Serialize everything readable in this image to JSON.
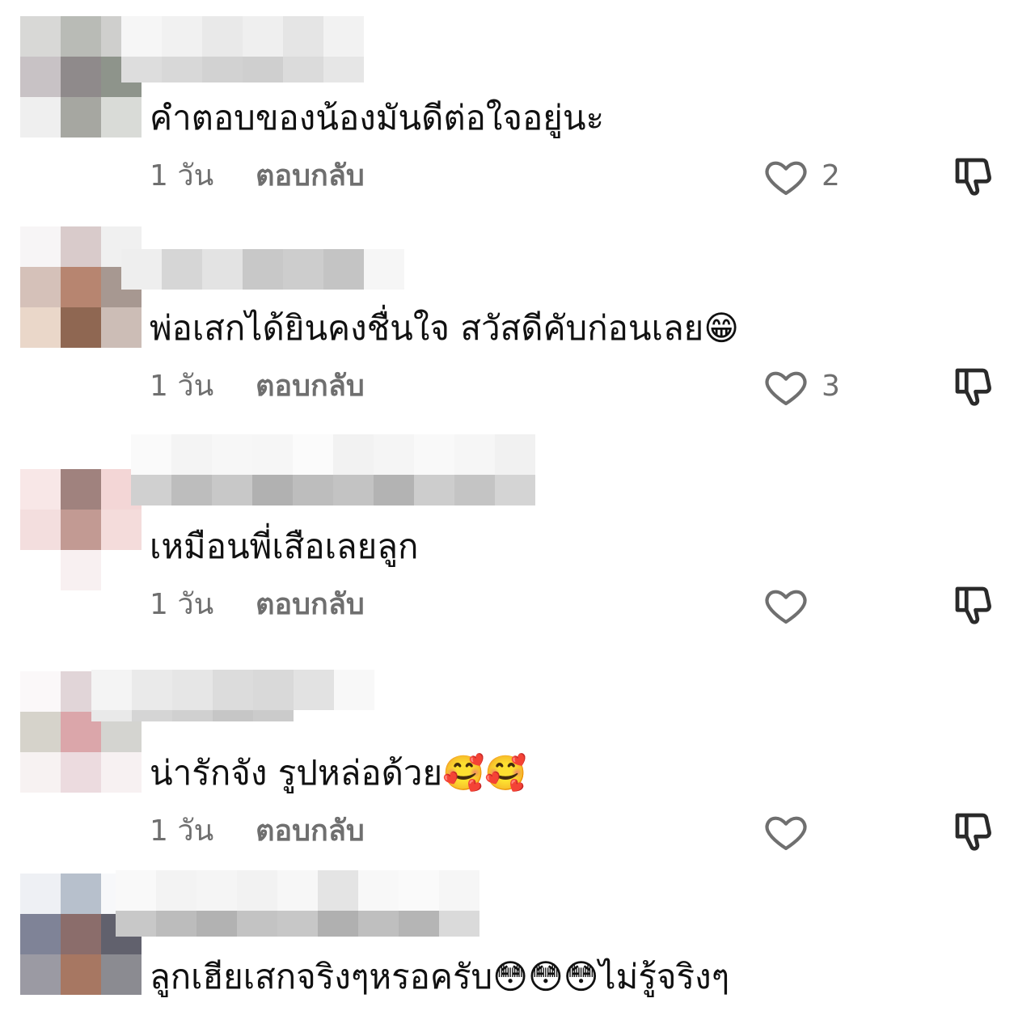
{
  "comments": [
    {
      "text": "คำตอบของน้องมันดีต่อใจอยู่นะ",
      "time": "1 วัน",
      "reply_label": "ตอบกลับ",
      "likes": "2"
    },
    {
      "text": "พ่อเสกได้ยินคงชื่นใจ สวัสดีคับก่อนเลย😁",
      "time": "1 วัน",
      "reply_label": "ตอบกลับ",
      "likes": "3"
    },
    {
      "text": "เหมือนพี่เสือเลยลูก",
      "time": "1 วัน",
      "reply_label": "ตอบกลับ",
      "likes": ""
    },
    {
      "text": "น่ารักจัง รูปหล่อด้วย🥰🥰",
      "time": "1 วัน",
      "reply_label": "ตอบกลับ",
      "likes": ""
    },
    {
      "text": "ลูกเฮียเสกจริงๆหรอครับ😳😳😳ไม่รู้จริงๆ",
      "time": "",
      "reply_label": "",
      "likes": ""
    }
  ],
  "icons": {
    "like": "heart-outline-icon",
    "dislike": "thumbs-down-outline-icon"
  },
  "colors": {
    "meta_text": "#6f6f6f",
    "text": "#111111",
    "background": "#ffffff"
  }
}
